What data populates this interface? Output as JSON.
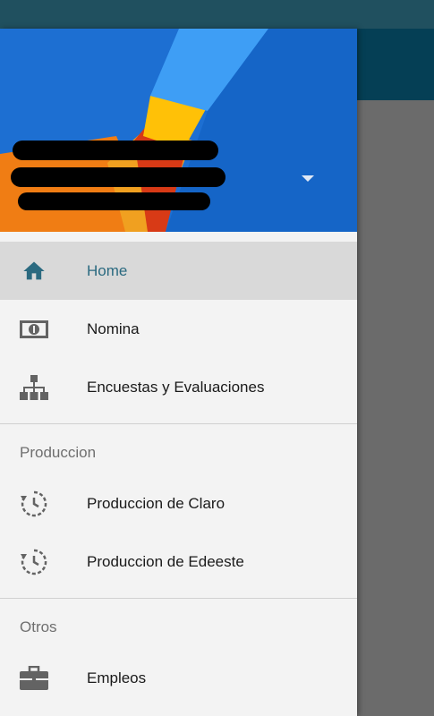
{
  "colors": {
    "status_bar": "#20505f",
    "app_bar": "#053f55",
    "drawer_bg": "#f3f3f3",
    "active_bg": "#d9d9d9",
    "active_text": "#2b6a80",
    "icon_gray": "#636363"
  },
  "header": {
    "account_dropdown_icon": "arrow-drop-down-icon"
  },
  "menu": {
    "primary": [
      {
        "label": "Home",
        "icon": "home-icon",
        "active": true
      },
      {
        "label": "Nomina",
        "icon": "money-icon",
        "active": false
      },
      {
        "label": "Encuestas y Evaluaciones",
        "icon": "org-chart-icon",
        "active": false
      }
    ],
    "sections": [
      {
        "title": "Produccion",
        "items": [
          {
            "label": "Produccion de Claro",
            "icon": "history-clock-icon"
          },
          {
            "label": "Produccion de Edeeste",
            "icon": "history-clock-icon"
          }
        ]
      },
      {
        "title": "Otros",
        "items": [
          {
            "label": "Empleos",
            "icon": "briefcase-icon"
          }
        ]
      }
    ]
  }
}
